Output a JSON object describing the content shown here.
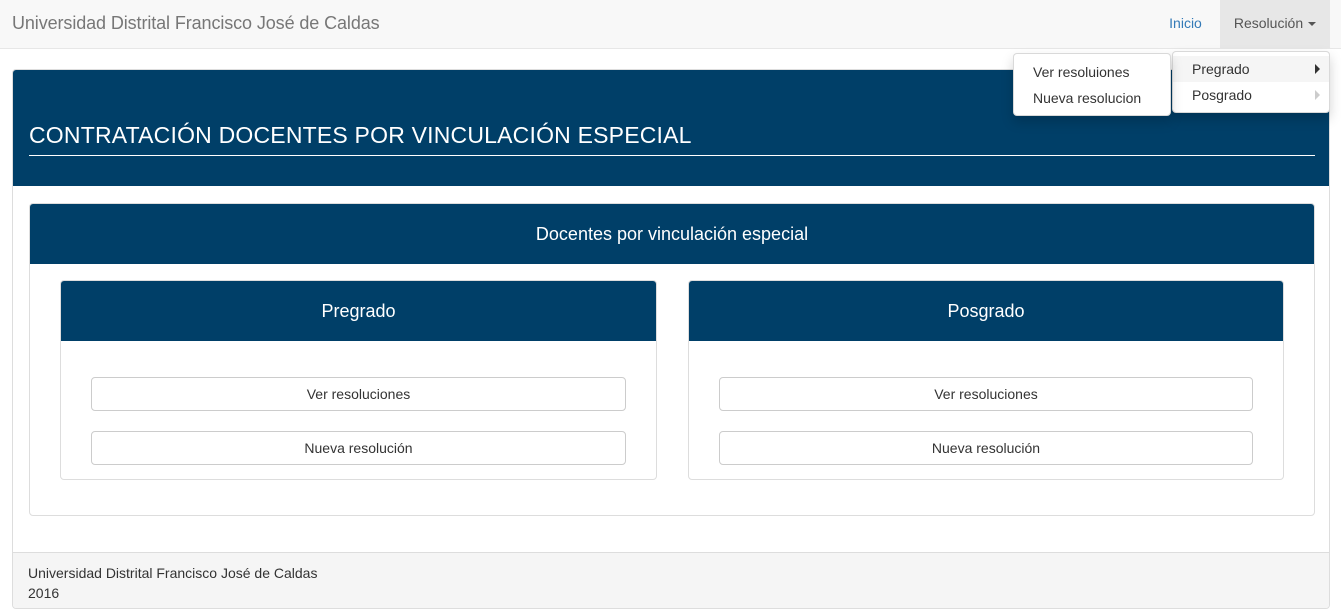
{
  "navbar": {
    "brand": "Universidad Distrital Francisco José de Caldas",
    "links": [
      {
        "label": "Inicio"
      },
      {
        "label": "Resolución"
      }
    ]
  },
  "dropdown": {
    "items": [
      {
        "label": "Pregrado",
        "active": true
      },
      {
        "label": "Posgrado",
        "active": false
      }
    ],
    "submenu": [
      {
        "label": "Ver resoluiones"
      },
      {
        "label": "Nueva resolucion"
      }
    ]
  },
  "main": {
    "title": "CONTRATACIÓN DOCENTES POR VINCULACIÓN ESPECIAL",
    "panel_title": "Docentes por vinculación especial",
    "cards": [
      {
        "title": "Pregrado",
        "buttons": [
          "Ver resoluciones",
          "Nueva resolución"
        ]
      },
      {
        "title": "Posgrado",
        "buttons": [
          "Ver resoluciones",
          "Nueva resolución"
        ]
      }
    ]
  },
  "footer": {
    "line1": "Universidad Distrital Francisco José de Caldas",
    "line2": "2016"
  },
  "colors": {
    "primary": "#003f68",
    "navbar_bg": "#f8f8f8",
    "link": "#337ab7"
  }
}
